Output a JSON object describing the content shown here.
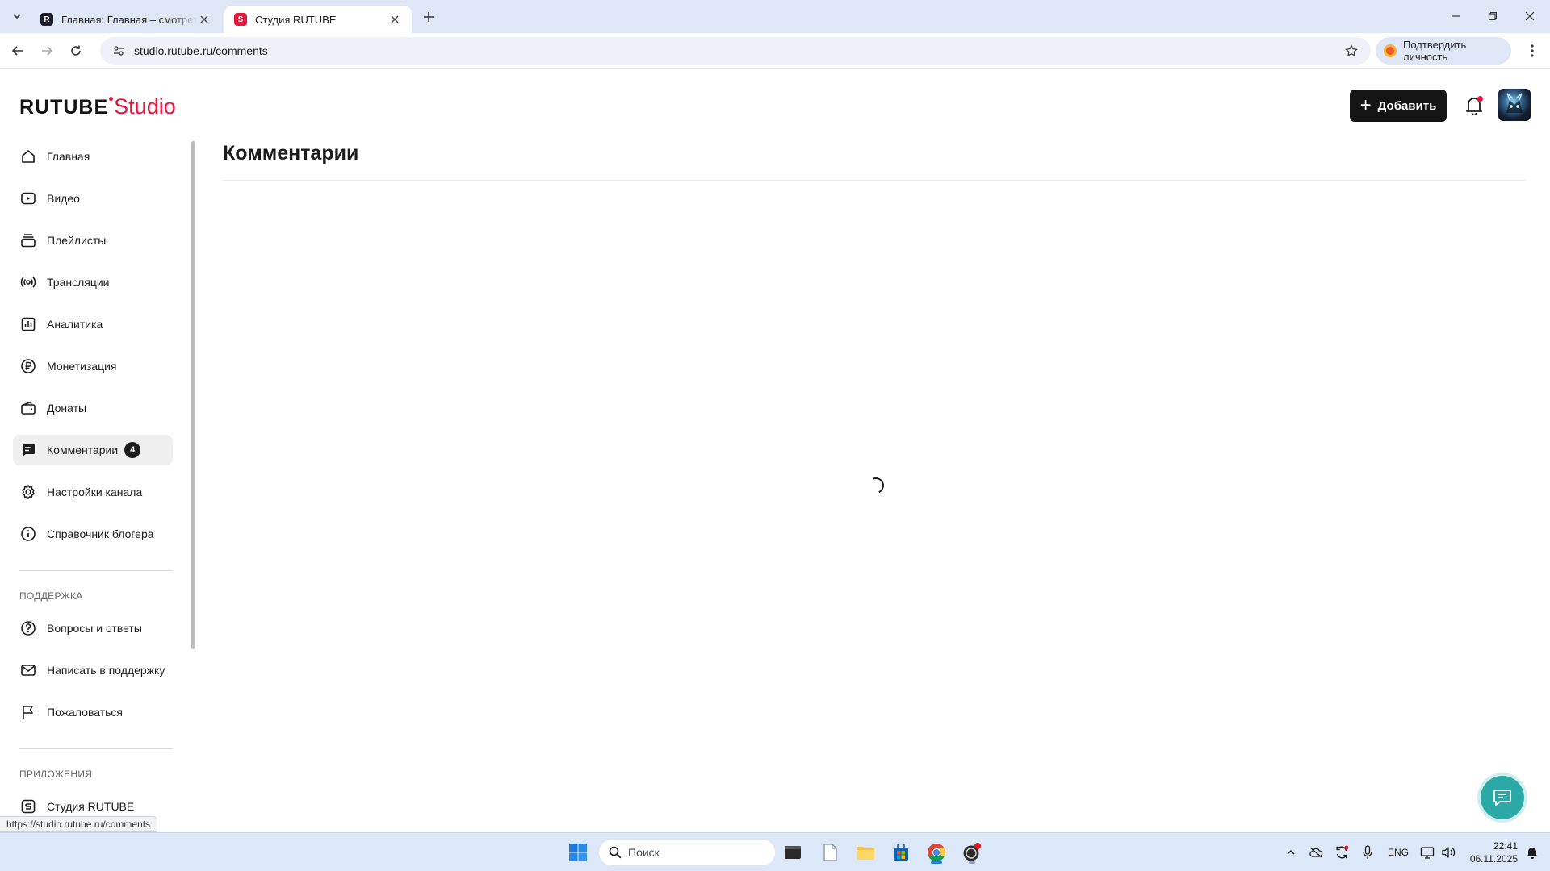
{
  "browser": {
    "tabs": [
      {
        "title": "Главная: Главная – смотреть онлайн",
        "favicon": "rutube-icon",
        "favicon_color": "#1d1d2b",
        "active": false
      },
      {
        "title": "Студия RUTUBE",
        "favicon": "rutube-studio-icon",
        "favicon_color": "#ed143b",
        "active": true
      }
    ],
    "url": "studio.rutube.ru/comments",
    "verify_label": "Подтвердить личность",
    "status_url": "https://studio.rutube.ru/comments"
  },
  "header": {
    "logo_main": "RUTUBE",
    "logo_suffix": "Studio",
    "add_label": "Добавить",
    "accent_color": "#ed143b"
  },
  "sidebar": {
    "items": [
      {
        "label": "Главная",
        "icon": "home-icon"
      },
      {
        "label": "Видео",
        "icon": "video-icon"
      },
      {
        "label": "Плейлисты",
        "icon": "playlists-icon"
      },
      {
        "label": "Трансляции",
        "icon": "broadcast-icon"
      },
      {
        "label": "Аналитика",
        "icon": "analytics-icon"
      },
      {
        "label": "Монетизация",
        "icon": "ruble-icon"
      },
      {
        "label": "Донаты",
        "icon": "wallet-icon"
      },
      {
        "label": "Комментарии",
        "icon": "comments-icon",
        "badge": "4",
        "active": true
      },
      {
        "label": "Настройки канала",
        "icon": "gear-icon"
      },
      {
        "label": "Справочник блогера",
        "icon": "info-icon"
      }
    ],
    "support_heading": "ПОДДЕРЖКА",
    "support_items": [
      {
        "label": "Вопросы и ответы",
        "icon": "question-icon"
      },
      {
        "label": "Написать в поддержку",
        "icon": "mail-icon"
      },
      {
        "label": "Пожаловаться",
        "icon": "flag-icon"
      }
    ],
    "apps_heading": "ПРИЛОЖЕНИЯ",
    "apps_items": [
      {
        "label": "Студия RUTUBE",
        "icon": "studio-app-icon"
      }
    ]
  },
  "main": {
    "title": "Комментарии",
    "loading": true
  },
  "taskbar": {
    "search_placeholder": "Поиск",
    "lang": "ENG",
    "time": "22:41",
    "date": "06.11.2025"
  }
}
